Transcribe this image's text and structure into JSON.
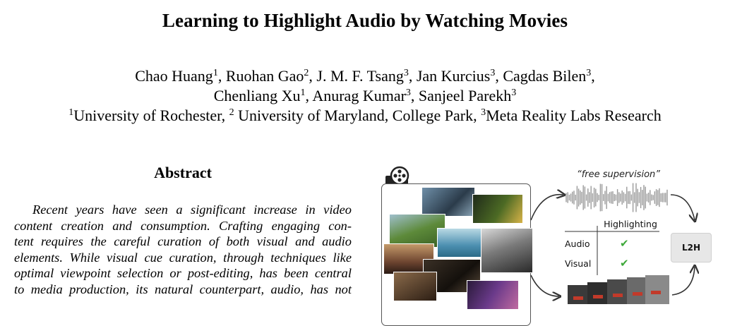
{
  "paper": {
    "title": "Learning to Highlight Audio by Watching Movies",
    "authors_line1": [
      {
        "name": "Chao Huang",
        "sup": "1",
        "sep": ", "
      },
      {
        "name": "Ruohan Gao",
        "sup": "2",
        "sep": ", "
      },
      {
        "name": "J. M. F. Tsang",
        "sup": "3",
        "sep": ", "
      },
      {
        "name": "Jan Kurcius",
        "sup": "3",
        "sep": ", "
      },
      {
        "name": "Cagdas Bilen",
        "sup": "3",
        "sep": ","
      }
    ],
    "authors_line2": [
      {
        "name": "Chenliang Xu",
        "sup": "1",
        "sep": ", "
      },
      {
        "name": "Anurag Kumar",
        "sup": "3",
        "sep": ", "
      },
      {
        "name": "Sanjeel Parekh",
        "sup": "3",
        "sep": ""
      }
    ],
    "affiliations": [
      {
        "sup": "1",
        "name": "University of Rochester, "
      },
      {
        "sup": "2",
        "name": " University of Maryland, College Park, "
      },
      {
        "sup": "3",
        "name": "Meta Reality Labs Research"
      }
    ]
  },
  "abstract": {
    "heading": "Abstract",
    "lines": [
      "Recent years have seen a significant increase in video",
      "content creation and consumption. Crafting engaging con-",
      "tent requires the careful curation of both visual and audio",
      "elements. While visual cue curation, through techniques like",
      "optimal viewpoint selection or post-editing, has been central",
      "to media production, its natural counterpart, audio, has not"
    ]
  },
  "figure": {
    "supervision_label": "“free supervision”",
    "table_header": "Highlighting",
    "rows": [
      {
        "label": "Audio",
        "check": "✔"
      },
      {
        "label": "Visual",
        "check": "✔"
      }
    ],
    "model_label": "L2H",
    "icons": [
      "film-reel-icon",
      "check-icon"
    ],
    "colors": {
      "check": "#3ea83a",
      "waveform": "#9a9a9a",
      "box": "#e7e7e7"
    }
  }
}
